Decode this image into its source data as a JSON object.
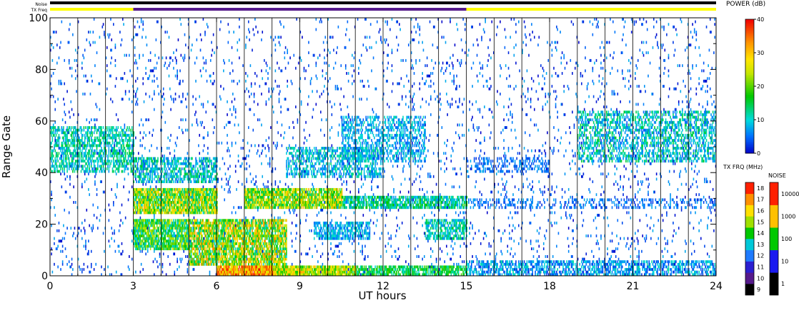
{
  "chart_data": {
    "type": "heatmap",
    "title": "",
    "xlabel": "UT hours",
    "ylabel": "Range Gate",
    "xlim": [
      0,
      24
    ],
    "ylim": [
      0,
      100
    ],
    "x_ticks": [
      "0",
      "3",
      "6",
      "9",
      "12",
      "15",
      "18",
      "21",
      "24"
    ],
    "y_ticks": [
      "0",
      "20",
      "40",
      "60",
      "80",
      "100"
    ],
    "status_bars": {
      "noise_label": "Noise",
      "txfreq_label": "TX Freq",
      "txfreq_segments": [
        {
          "start": 0,
          "end": 3,
          "color": "#ffff00"
        },
        {
          "start": 3,
          "end": 15,
          "color": "#551a8b"
        },
        {
          "start": 15,
          "end": 24,
          "color": "#ffff00"
        }
      ],
      "noise_color": "#000000"
    },
    "power_scale": {
      "label": "POWER (dB)",
      "min": 0,
      "max": 40,
      "ticks": [
        "0",
        "10",
        "20",
        "30",
        "40"
      ]
    },
    "txfreq_scale": {
      "label": "TX FRQ (MHz)",
      "ticks": [
        "9",
        "10",
        "11",
        "12",
        "13",
        "14",
        "15",
        "16",
        "17",
        "18"
      ],
      "colors": [
        "#000000",
        "#551a8b",
        "#2b1fd0",
        "#1f7bff",
        "#00c8d8",
        "#00c800",
        "#a0e000",
        "#ffe000",
        "#ff9000",
        "#ff2000"
      ]
    },
    "noise_scale": {
      "label": "NOISE",
      "ticks": [
        "1",
        "10",
        "100",
        "1000",
        "10000"
      ],
      "colors": [
        "#000000",
        "#1a1af0",
        "#00c800",
        "#ffc000",
        "#ff2000"
      ]
    },
    "regions": [
      {
        "t0": 0,
        "t1": 3,
        "g0": 40,
        "g1": 58,
        "p0": 6,
        "p1": 16,
        "d": 0.55
      },
      {
        "t0": 3,
        "t1": 6,
        "g0": 24,
        "g1": 34,
        "p0": 10,
        "p1": 32,
        "d": 0.9
      },
      {
        "t0": 3,
        "t1": 5,
        "g0": 10,
        "g1": 22,
        "p0": 8,
        "p1": 26,
        "d": 0.85
      },
      {
        "t0": 5,
        "t1": 8.5,
        "g0": 4,
        "g1": 22,
        "p0": 10,
        "p1": 34,
        "d": 0.8
      },
      {
        "t0": 6,
        "t1": 8,
        "g0": 0,
        "g1": 4,
        "p0": 24,
        "p1": 40,
        "d": 0.95
      },
      {
        "t0": 8,
        "t1": 11,
        "g0": 0,
        "g1": 4,
        "p0": 16,
        "p1": 32,
        "d": 0.9
      },
      {
        "t0": 11,
        "t1": 15,
        "g0": 0,
        "g1": 4,
        "p0": 10,
        "p1": 20,
        "d": 0.75
      },
      {
        "t0": 7,
        "t1": 10.5,
        "g0": 26,
        "g1": 34,
        "p0": 12,
        "p1": 32,
        "d": 0.85
      },
      {
        "t0": 10,
        "t1": 15,
        "g0": 26,
        "g1": 31,
        "p0": 6,
        "p1": 18,
        "d": 0.75
      },
      {
        "t0": 3,
        "t1": 6,
        "g0": 36,
        "g1": 46,
        "p0": 4,
        "p1": 16,
        "d": 0.55
      },
      {
        "t0": 8.5,
        "t1": 12,
        "g0": 38,
        "g1": 50,
        "p0": 4,
        "p1": 14,
        "d": 0.45
      },
      {
        "t0": 10.5,
        "t1": 13.5,
        "g0": 44,
        "g1": 62,
        "p0": 4,
        "p1": 12,
        "d": 0.45
      },
      {
        "t0": 13.5,
        "t1": 15,
        "g0": 14,
        "g1": 22,
        "p0": 6,
        "p1": 16,
        "d": 0.65
      },
      {
        "t0": 9.5,
        "t1": 11.5,
        "g0": 14,
        "g1": 21,
        "p0": 4,
        "p1": 12,
        "d": 0.6
      },
      {
        "t0": 15,
        "t1": 24,
        "g0": 0,
        "g1": 6,
        "p0": 2,
        "p1": 12,
        "d": 0.55
      },
      {
        "t0": 19,
        "t1": 24,
        "g0": 44,
        "g1": 64,
        "p0": 4,
        "p1": 16,
        "d": 0.45
      },
      {
        "t0": 15,
        "t1": 24,
        "g0": 26,
        "g1": 30,
        "p0": 2,
        "p1": 8,
        "d": 0.3
      },
      {
        "t0": 15,
        "t1": 18,
        "g0": 40,
        "g1": 46,
        "p0": 2,
        "p1": 8,
        "d": 0.3
      },
      {
        "t0": 0,
        "t1": 24,
        "g0": 0,
        "g1": 100,
        "p0": 0,
        "p1": 8,
        "d": 0.045
      }
    ]
  }
}
